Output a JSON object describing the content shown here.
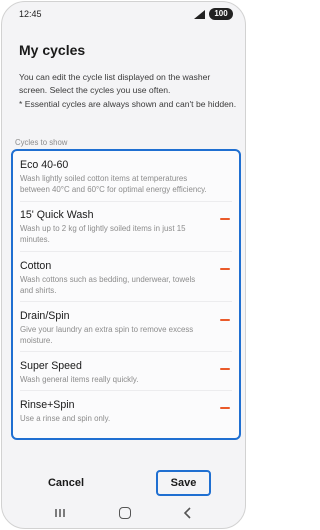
{
  "status_bar": {
    "time": "12:45",
    "battery": "100",
    "icons": [
      "signal-icon",
      "battery-icon"
    ]
  },
  "header": {
    "title": "My cycles",
    "description_line1": "You can edit the cycle list displayed on the washer screen. Select the cycles you use often.",
    "description_line2": "* Essential cycles are always shown and can't be hidden."
  },
  "section_label": "Cycles to show",
  "cycles": [
    {
      "name": "Eco 40-60",
      "description": "Wash lightly soiled cotton items at temperatures between 40°C and 60°C for optimal energy efficiency."
    },
    {
      "name": "15' Quick Wash",
      "description": "Wash up to 2 kg of lightly soiled items in just 15 minutes."
    },
    {
      "name": "Cotton",
      "description": "Wash cottons such as bedding, underwear, towels and shirts."
    },
    {
      "name": "Drain/Spin",
      "description": "Give your laundry an extra spin to remove excess moisture."
    },
    {
      "name": "Super Speed",
      "description": "Wash general items really quickly."
    },
    {
      "name": "Rinse+Spin",
      "description": "Use a rinse and spin only."
    }
  ],
  "footer": {
    "cancel_label": "Cancel",
    "save_label": "Save"
  },
  "colors": {
    "accent": "#1f6fd1",
    "remove": "#ea5a2a"
  },
  "nav_bar": {
    "icons": [
      "recent-apps-icon",
      "home-icon",
      "back-icon"
    ]
  }
}
